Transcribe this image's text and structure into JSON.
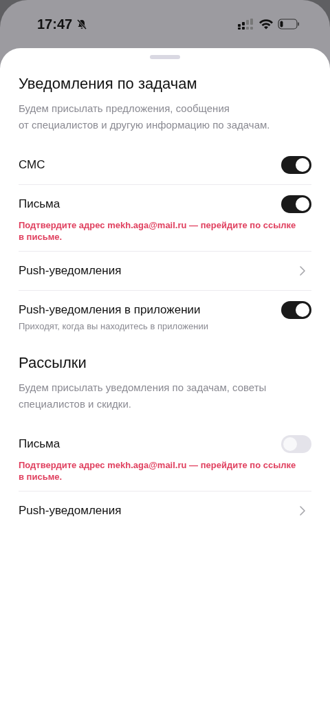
{
  "status_bar": {
    "time": "17:47"
  },
  "sections": [
    {
      "title": "Уведомления по задачам",
      "description": "Будем присылать предложения, сообщения\nот специалистов и другую информацию по задачам.",
      "rows": [
        {
          "kind": "toggle",
          "label": "СМС",
          "on": true,
          "disabled": false
        },
        {
          "kind": "toggle",
          "label": "Письма",
          "on": true,
          "disabled": false,
          "warning": "Подтвердите адрес mekh.aga@mail.ru — перейдите по ссылке\nв письме."
        },
        {
          "kind": "link",
          "label": "Push-уведомления"
        },
        {
          "kind": "toggle",
          "label": "Push-уведомления в приложении",
          "on": true,
          "disabled": false,
          "hint": "Приходят, когда вы находитесь в приложении"
        }
      ]
    },
    {
      "title": "Рассылки",
      "description": "Будем присылать уведомления по задачам, советы\nспециалистов и скидки.",
      "rows": [
        {
          "kind": "toggle",
          "label": "Письма",
          "on": false,
          "disabled": true,
          "warning": "Подтвердите адрес mekh.aga@mail.ru — перейдите по ссылке\nв письме."
        },
        {
          "kind": "link",
          "label": "Push-уведомления"
        }
      ]
    }
  ]
}
